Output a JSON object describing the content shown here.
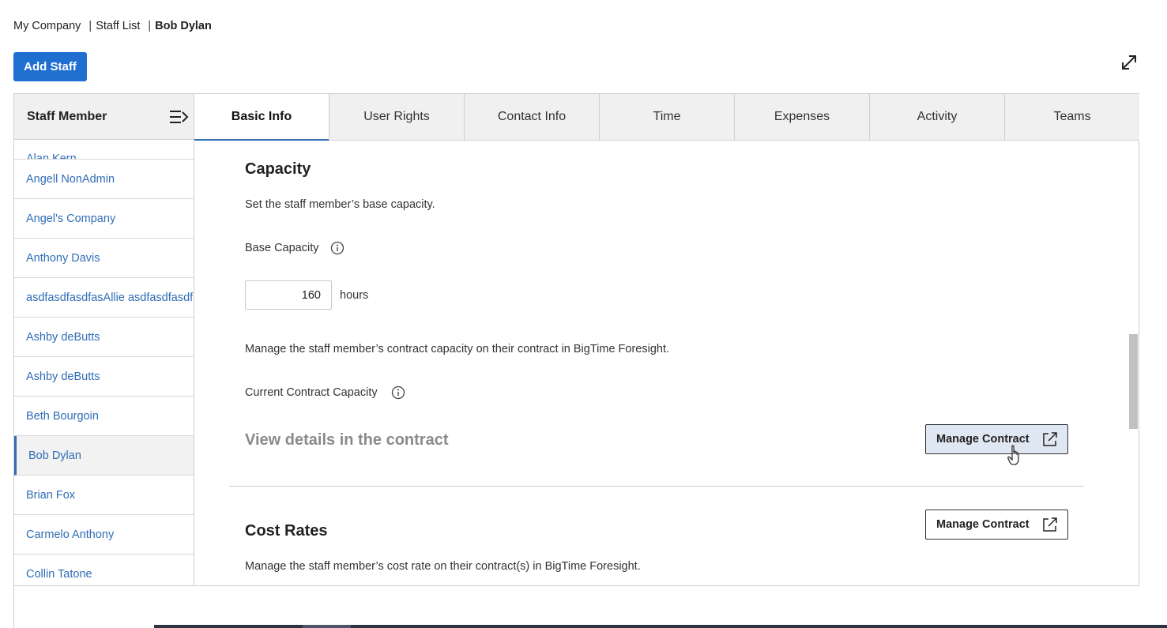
{
  "breadcrumb": {
    "items": [
      "My Company",
      "Staff List"
    ],
    "separator": "|",
    "current": "Bob Dylan"
  },
  "toolbar": {
    "add_staff_label": "Add Staff",
    "expand_icon": "expand-arrows-icon"
  },
  "sidebar": {
    "header": "Staff Member",
    "collapse_icon": "collapse-list-icon",
    "items": [
      "Alan Kern",
      "Angell NonAdmin",
      "Angel's Company",
      "Anthony Davis",
      "asdfasdfasdfasAllie asdfasdfasdf",
      "Ashby deButts",
      "Ashby deButts",
      "Beth Bourgoin",
      "Bob Dylan",
      "Brian Fox",
      "Carmelo Anthony",
      "Collin Tatone"
    ],
    "selected": "Bob Dylan"
  },
  "tabs": [
    {
      "label": "Basic Info",
      "active": true
    },
    {
      "label": "User Rights",
      "active": false
    },
    {
      "label": "Contact Info",
      "active": false
    },
    {
      "label": "Time",
      "active": false
    },
    {
      "label": "Expenses",
      "active": false
    },
    {
      "label": "Activity",
      "active": false
    },
    {
      "label": "Teams",
      "active": false
    }
  ],
  "capacity": {
    "title": "Capacity",
    "description": "Set the staff member’s base capacity.",
    "base_label": "Base Capacity",
    "base_value": "160",
    "unit": "hours",
    "contract_description": "Manage the staff member’s contract capacity on their contract in BigTime Foresight.",
    "current_label": "Current Contract Capacity",
    "view_details": "View details in the contract",
    "manage_label": "Manage Contract"
  },
  "cost_rates": {
    "title": "Cost Rates",
    "manage_label": "Manage Contract",
    "description": "Manage the staff member’s cost rate on their contract(s) in BigTime Foresight."
  },
  "colors": {
    "primary": "#1f6fd1",
    "link": "#2f6db5",
    "tab_bg": "#f0f0f0",
    "button_hover": "#dfe7f2",
    "muted_text": "#8a8a8a"
  }
}
